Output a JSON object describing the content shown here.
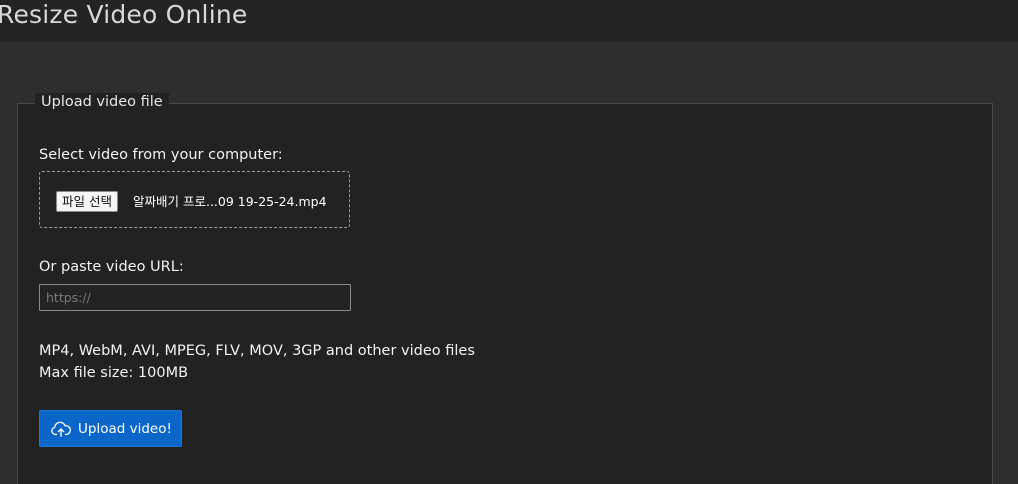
{
  "header": {
    "title": "Resize Video Online"
  },
  "upload_panel": {
    "legend": "Upload video file",
    "select_label": "Select video from your computer:",
    "file_button_label": "파일 선택",
    "file_name": "알짜배기 프로...09 19-25-24.mp4",
    "url_label": "Or paste video URL:",
    "url_input": {
      "value": "",
      "placeholder": "https://"
    },
    "formats_text": "MP4, WebM, AVI, MPEG, FLV, MOV, 3GP and other video files",
    "max_size_text": "Max file size: 100MB",
    "upload_button_label": "Upload video!",
    "upload_icon": "cloud-upload-icon"
  },
  "colors": {
    "primary_button": "#0a66c9",
    "panel_background": "#222222",
    "page_background": "#2e2e2e"
  }
}
